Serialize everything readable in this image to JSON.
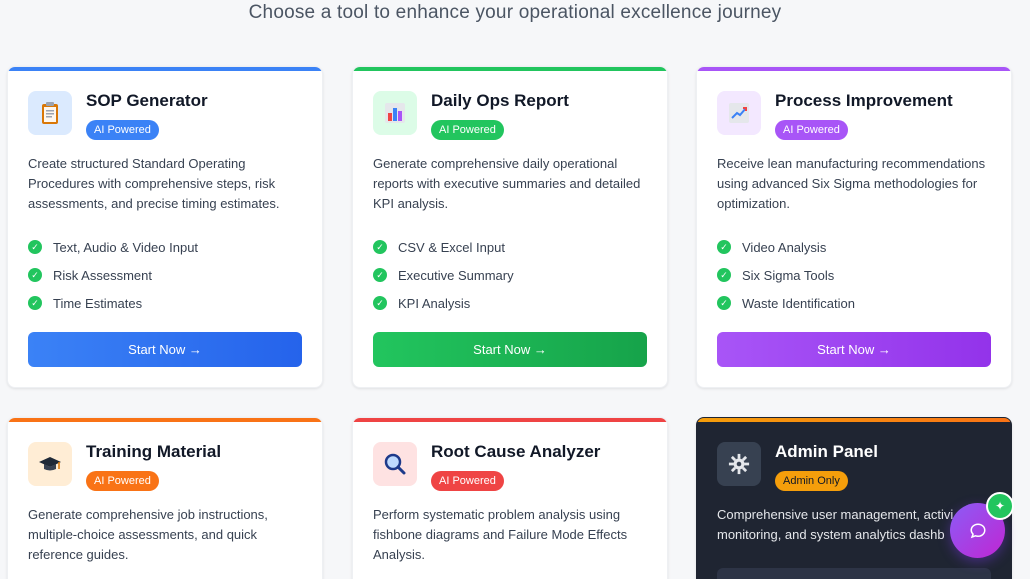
{
  "subtitle": "Choose a tool to enhance your operational excellence journey",
  "colors": {
    "blue": "#3b82f6",
    "green": "#22c55e",
    "purple": "#a855f7",
    "orange": "#f97316",
    "red": "#ef4444",
    "amber": "#f59e0b"
  },
  "cards": [
    {
      "title": "SOP Generator",
      "badge": "AI Powered",
      "icon": "clipboard-icon",
      "description": "Create structured Standard Operating Procedures with comprehensive steps, risk assessments, and precise timing estimates.",
      "features": [
        "Text, Audio & Video Input",
        "Risk Assessment",
        "Time Estimates"
      ],
      "button": "Start Now →"
    },
    {
      "title": "Daily Ops Report",
      "badge": "AI Powered",
      "icon": "bar-chart-icon",
      "description": "Generate comprehensive daily operational reports with executive summaries and detailed KPI analysis.",
      "features": [
        "CSV & Excel Input",
        "Executive Summary",
        "KPI Analysis"
      ],
      "button": "Start Now →"
    },
    {
      "title": "Process Improvement",
      "badge": "AI Powered",
      "icon": "trend-chart-icon",
      "description": "Receive lean manufacturing recommendations using advanced Six Sigma methodologies for optimization.",
      "features": [
        "Video Analysis",
        "Six Sigma Tools",
        "Waste Identification"
      ],
      "button": "Start Now →"
    },
    {
      "title": "Training Material",
      "badge": "AI Powered",
      "icon": "graduation-cap-icon",
      "description": "Generate comprehensive job instructions, multiple-choice assessments, and quick reference guides."
    },
    {
      "title": "Root Cause Analyzer",
      "badge": "AI Powered",
      "icon": "magnifier-icon",
      "description": "Perform systematic problem analysis using fishbone diagrams and Failure Mode Effects Analysis."
    },
    {
      "title": "Admin Panel",
      "badge": "Admin Only",
      "icon": "gear-icon",
      "description": "Comprehensive user management, activi monitoring, and system analytics dashb"
    }
  ]
}
